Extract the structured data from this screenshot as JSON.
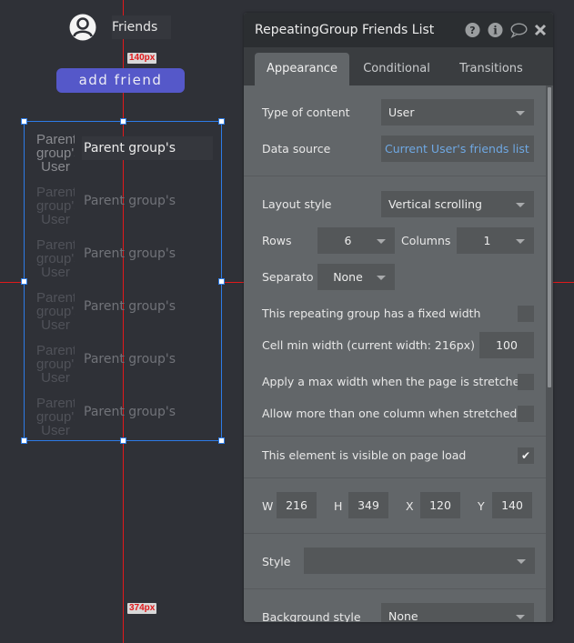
{
  "canvas": {
    "header": {
      "title": "Friends",
      "avatar_icon": "user-avatar-icon"
    },
    "add_friend_button": {
      "label": "add friend",
      "color": "#5558c9"
    },
    "guides": {
      "top_distance": "140px",
      "bottom_distance": "374px",
      "guide_color": "#e0191b"
    },
    "repeating_group": {
      "selection_color": "#2d7be6",
      "cells": [
        {
          "avatar_text": "Parent group's User",
          "text": "Parent group's"
        },
        {
          "avatar_text": "Parent group's User",
          "text": "Parent group's"
        },
        {
          "avatar_text": "Parent group's User",
          "text": "Parent group's"
        },
        {
          "avatar_text": "Parent group's User",
          "text": "Parent group's"
        },
        {
          "avatar_text": "Parent group's User",
          "text": "Parent group's"
        },
        {
          "avatar_text": "Parent group's User",
          "text": "Parent group's"
        }
      ]
    }
  },
  "panel": {
    "title": "RepeatingGroup Friends List",
    "header_icons": [
      "help-icon",
      "info-icon",
      "comment-icon",
      "close-icon"
    ],
    "tabs": [
      {
        "label": "Appearance",
        "active": true
      },
      {
        "label": "Conditional",
        "active": false
      },
      {
        "label": "Transitions",
        "active": false
      }
    ],
    "type_of_content": {
      "label": "Type of content",
      "value": "User"
    },
    "data_source": {
      "label": "Data source",
      "value": "Current User's friends list",
      "link_color": "#6fa8e3"
    },
    "layout_style": {
      "label": "Layout style",
      "value": "Vertical scrolling"
    },
    "rows": {
      "label": "Rows",
      "value": "6"
    },
    "columns": {
      "label": "Columns",
      "value": "1"
    },
    "separator": {
      "label": "Separato",
      "value": "None"
    },
    "fixed_width": {
      "label": "This repeating group has a fixed width",
      "checked": false
    },
    "cell_min_width": {
      "label": "Cell min width (current width: 216px)",
      "value": "100"
    },
    "max_width": {
      "label": "Apply a max width when the page is stretched",
      "checked": false
    },
    "multi_column": {
      "label": "Allow more than one column when stretched",
      "checked": false
    },
    "visible_on_load": {
      "label": "This element is visible on page load",
      "checked": true,
      "check_glyph": "✔"
    },
    "geometry": {
      "w": {
        "label": "W",
        "value": "216"
      },
      "h": {
        "label": "H",
        "value": "349"
      },
      "x": {
        "label": "X",
        "value": "120"
      },
      "y": {
        "label": "Y",
        "value": "140"
      }
    },
    "style": {
      "label": "Style",
      "value": ""
    },
    "background_style": {
      "label": "Background style",
      "value": "None"
    }
  }
}
